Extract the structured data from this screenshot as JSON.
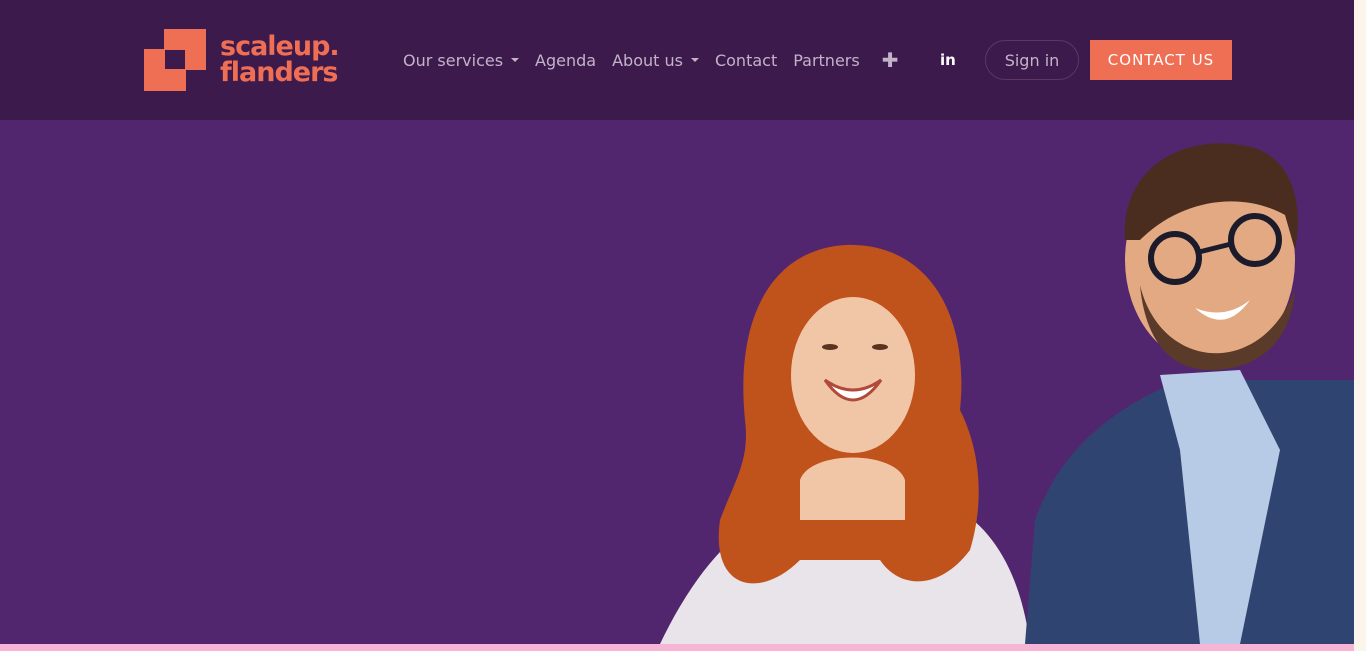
{
  "brand": {
    "line1": "scaleup.",
    "line2": "flanders",
    "color": "#ef6f55"
  },
  "nav": {
    "items": [
      {
        "label": "Our services",
        "dropdown": true
      },
      {
        "label": "Agenda",
        "dropdown": false
      },
      {
        "label": "About us",
        "dropdown": true
      },
      {
        "label": "Contact",
        "dropdown": false
      },
      {
        "label": "Partners",
        "dropdown": false
      }
    ],
    "plus_icon": "✚",
    "linkedin_label": "in",
    "signin_label": "Sign in",
    "contact_label": "CONTACT US"
  },
  "colors": {
    "navbar_bg": "#3d1a4c",
    "hero_bg": "#52266f",
    "accent": "#ef6f55",
    "strip": "#f7b4d5"
  }
}
